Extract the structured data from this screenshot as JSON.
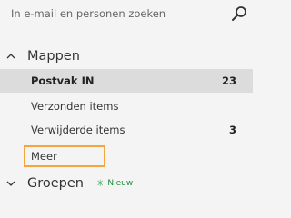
{
  "search": {
    "placeholder": "In e-mail en personen zoeken",
    "icon": "search-icon"
  },
  "folders": {
    "header": "Mappen",
    "expanded": true,
    "items": [
      {
        "label": "Postvak IN",
        "count": "23",
        "selected": true
      },
      {
        "label": "Verzonden items",
        "count": ""
      },
      {
        "label": "Verwijderde items",
        "count": "3"
      }
    ],
    "more_label": "Meer"
  },
  "groups": {
    "header": "Groepen",
    "expanded": false,
    "new_badge": "Nieuw"
  },
  "colors": {
    "background": "#f4f4f4",
    "selected_row": "#dcdcdc",
    "highlight_border": "#f2a640",
    "new_badge": "#1a8c3a"
  }
}
